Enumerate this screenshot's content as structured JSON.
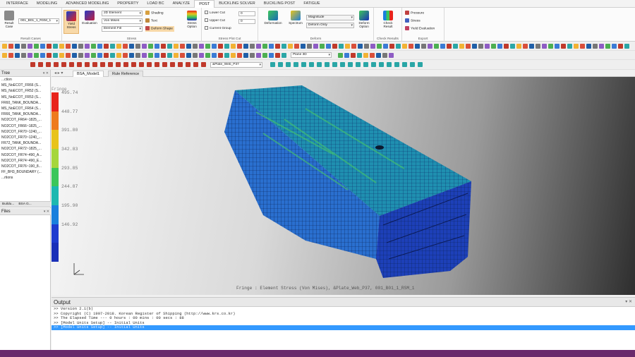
{
  "menu": {
    "tabs": [
      "INTERFACE",
      "MODELING",
      "ADVANCED MODELING",
      "PROPERTY",
      "LOAD BC",
      "ANALYZE",
      "POST",
      "BUCKLING SOLVER",
      "BUCKLING POST",
      "FATIGUE"
    ],
    "active": "POST"
  },
  "ribbon": {
    "result_case": {
      "button": "Result Case",
      "value": "001_B01_1_RSM_1",
      "group": "Result Cases"
    },
    "stress": {
      "yield_stress": "Yield Stress",
      "evaluation": "Evaluation",
      "element_type": "2D Element",
      "stress_type": "Von Mises",
      "fill": "Element Fill",
      "shading": "Shading",
      "text": "Text",
      "deform_shape": "Deform Shape",
      "option": "Stress Option",
      "group": "Stress"
    },
    "plot_cut": {
      "lower_cut": "Lower Cut",
      "upper_cut": "Upper Cut",
      "current_group": "Current Group",
      "lower_value": "0",
      "upper_value": "0",
      "group": "Stress Plot Cut"
    },
    "deform": {
      "deformation": "Deformation",
      "spectrum": "Spectrum",
      "magnitude": "Magnitude",
      "deform_only": "Deform Only",
      "deform_option": "Deform Option",
      "group": "Deform"
    },
    "check": {
      "label": "Check Result",
      "group": "Check Results"
    },
    "export": {
      "pressure": "Pressure",
      "stress": "Stress",
      "yield_evaluation": "Yield Evaluation",
      "group": "Export"
    }
  },
  "toolbar": {
    "view_field": "Plane 3D",
    "result_select": "&Plate_Web_P37"
  },
  "tree_panel": {
    "title": "Tree",
    "root": "...ction",
    "items": [
      "MS_NoECOT_FR66 (S...",
      "MS_NoECOT_FR52 (S...",
      "MS_NoECOT_FR53 (S...",
      "FR60_TANK_BOUNDA...",
      "MS_NoECOT_FR64 (S...",
      "FR66_TANK_BOUNDA...",
      "NO2COT_FR64~1825_...",
      "NO2COT_FR66~1825_...",
      "NO2COT_FR70~1240_...",
      "NO2COT_FR70~1240_...",
      "FR72_TANK_BOUNDA...",
      "NO2COT_FR72~1825_...",
      "NO2COT_FR74~490_A...",
      "NO2COT_FR74~490_E...",
      "NO2COT_FR76~190_8...",
      "FF_BH3_BOUNDARY (...",
      "...rtions"
    ],
    "tabs": [
      "Buildu...",
      "BSA G..."
    ]
  },
  "files_panel": {
    "title": "Files"
  },
  "doc_tabs": [
    "BSA_Model1",
    "Rule Reference"
  ],
  "legend": {
    "title": "Fringe",
    "values": [
      "495.74",
      "448.77",
      "391.80",
      "342.83",
      "293.85",
      "244.87",
      "195.90",
      "146.92"
    ],
    "colors": [
      "#e8241c",
      "#ee7b1e",
      "#e8c31a",
      "#a6d63b",
      "#3cc65a",
      "#1db8b0",
      "#1a80dd",
      "#1f3ccf",
      "#1a30b8"
    ]
  },
  "fringe_caption": "Fringe : Element Stress (Von Mises), &Plate_Web_P37, 001_B01_1_RSM_1",
  "output": {
    "title": "Output",
    "lines": [
      ">> Version 2.1(b)",
      ">> Copyright (C) 1997-2018. Korean Register of Shipping (http://www.krs.co.kr)",
      ">> The Elapsed Time --- 0 hours : 00 mins : 00 secs : 88",
      ">> [Model Units Setup]  -- Initial Units"
    ],
    "highlight": ">> [Model Units Setup] -- Initial Units"
  }
}
